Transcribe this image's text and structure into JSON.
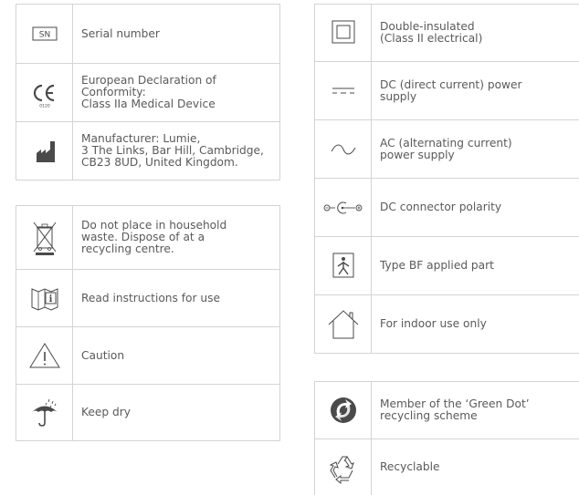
{
  "left_table_1": [
    {
      "icon": "serial-number-icon",
      "icon_text": "SN",
      "label": "Serial number"
    },
    {
      "icon": "ce-mark-icon",
      "icon_text": "0120",
      "label": "European Declaration of\nConformity:\nClass IIa Medical Device"
    },
    {
      "icon": "manufacturer-icon",
      "label": "Manufacturer: Lumie,\n3 The Links, Bar Hill, Cambridge,\nCB23 8UD, United Kingdom."
    }
  ],
  "left_table_2": [
    {
      "icon": "weee-bin-icon",
      "label": "Do not place in household\nwaste. Dispose of at a\nrecycling centre."
    },
    {
      "icon": "read-instructions-icon",
      "label": "Read instructions for use"
    },
    {
      "icon": "caution-icon",
      "label": "Caution"
    },
    {
      "icon": "keep-dry-icon",
      "label": "Keep dry"
    }
  ],
  "right_table_1": [
    {
      "icon": "double-insulated-icon",
      "label": "Double-insulated\n(Class II electrical)"
    },
    {
      "icon": "dc-power-icon",
      "label": "DC (direct current) power\nsupply"
    },
    {
      "icon": "ac-power-icon",
      "label": "AC (alternating current)\npower supply"
    },
    {
      "icon": "dc-polarity-icon",
      "label": "DC connector polarity"
    },
    {
      "icon": "type-bf-icon",
      "label": "Type BF applied part"
    },
    {
      "icon": "indoor-use-icon",
      "label": "For indoor use only"
    }
  ],
  "right_table_2": [
    {
      "icon": "green-dot-icon",
      "label": "Member of the ‘Green Dot’\nrecycling scheme"
    },
    {
      "icon": "recyclable-icon",
      "label": "Recyclable"
    }
  ],
  "colors": {
    "border": "#d4d4d4",
    "text": "#5a5a5a",
    "icon": "#4a4a4a"
  }
}
